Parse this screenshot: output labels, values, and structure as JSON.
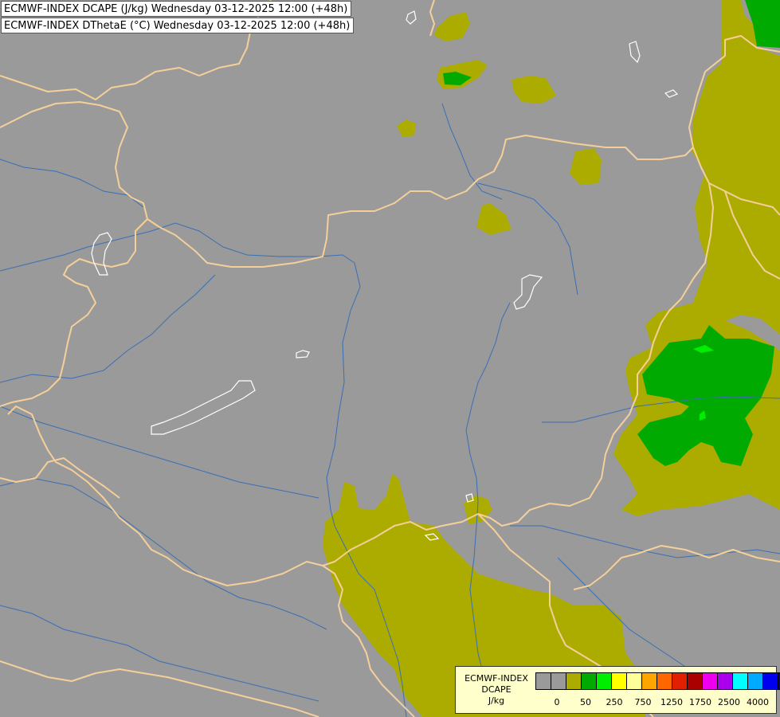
{
  "titles": {
    "line1": "ECMWF-INDEX DCAPE (J/kg) Wednesday 03-12-2025 12:00 (+48h)",
    "line2": "ECMWF-INDEX DThetaE (°C) Wednesday 03-12-2025 12:00 (+48h)"
  },
  "colors": {
    "background": "#9a9a9a",
    "low_fill": "#acac00",
    "mid_fill": "#00aa00",
    "high_fill": "#00ee00",
    "border": "#f5cf9a",
    "river": "#3a6fb5",
    "lake": "#ffffff"
  },
  "legend": {
    "line1": "ECMWF-INDEX",
    "line2": "DCAPE",
    "line3": "J/kg",
    "swatches": [
      "#9a9a9a",
      "#9a9a9a",
      "#acac00",
      "#00aa00",
      "#00ee00",
      "#ffff00",
      "#ffff99",
      "#ffa500",
      "#ff6600",
      "#e02000",
      "#aa0000",
      "#ee00ee",
      "#aa00ee",
      "#00ffff",
      "#00aaff",
      "#0000ee",
      "#000088"
    ],
    "ticks": [
      "0",
      "50",
      "250",
      "750",
      "1250",
      "1750",
      "2500",
      "4000"
    ]
  }
}
